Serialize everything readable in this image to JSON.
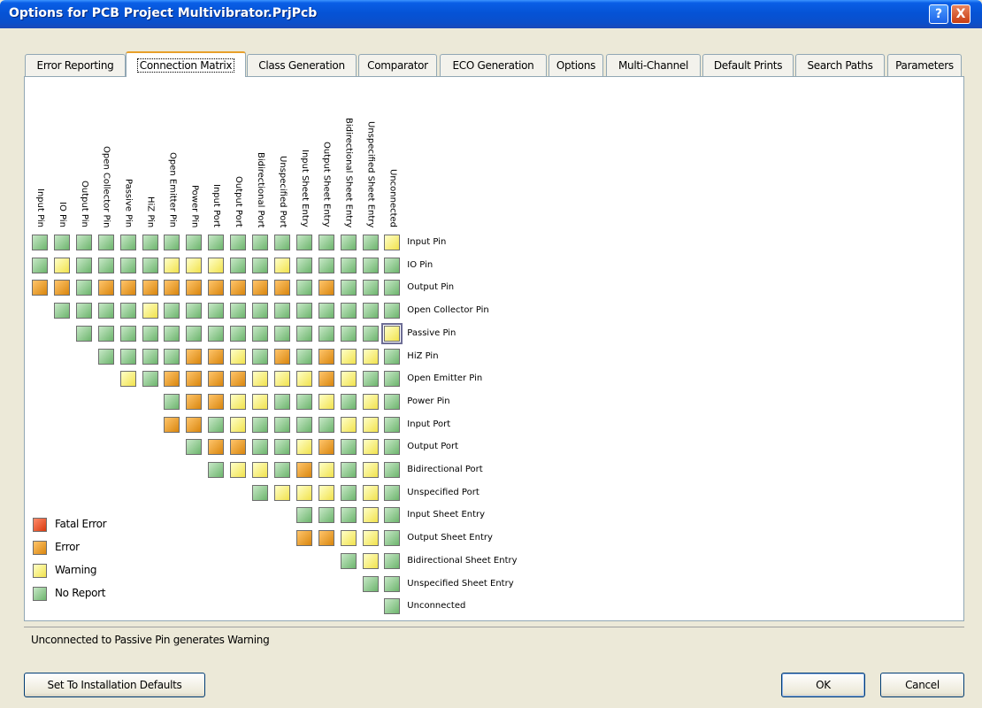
{
  "window": {
    "title": "Options for PCB Project Multivibrator.PrjPcb",
    "help_label": "?",
    "close_label": "X"
  },
  "tabs": [
    {
      "label": "Error Reporting"
    },
    {
      "label": "Connection Matrix"
    },
    {
      "label": "Class Generation"
    },
    {
      "label": "Comparator"
    },
    {
      "label": "ECO Generation"
    },
    {
      "label": "Options"
    },
    {
      "label": "Multi-Channel"
    },
    {
      "label": "Default Prints"
    },
    {
      "label": "Search Paths"
    },
    {
      "label": "Parameters"
    }
  ],
  "active_tab": "Connection Matrix",
  "matrix": {
    "labels": [
      "Input Pin",
      "IO Pin",
      "Output Pin",
      "Open Collector Pin",
      "Passive Pin",
      "HiZ Pin",
      "Open Emitter Pin",
      "Power Pin",
      "Input Port",
      "Output Port",
      "Bidirectional Port",
      "Unspecified Port",
      "Input Sheet Entry",
      "Output Sheet Entry",
      "Bidirectional Sheet Entry",
      "Unspecified Sheet Entry",
      "Unconnected"
    ],
    "levels": {
      "g": "No Report",
      "y": "Warning",
      "o": "Error",
      "r": "Fatal Error"
    },
    "rows": [
      "ggggggggggggggggy",
      "gyggggyyyggyggggg",
      "oogooooooooogoggg",
      "ggggyggggggggggg",
      "ggggggggggggggy",
      "ggggooygogoyyg",
      "ygooooyyyoygg",
      "gooyyggygyg",
      "oogyggggyyg",
      "googgyogyg",
      "gyygoygyg",
      "gyyygyg",
      "gggyg",
      "ooyyg",
      "gyg",
      "gg",
      "g"
    ],
    "selected": {
      "row": 4,
      "col": 16
    }
  },
  "legend": [
    {
      "label": "Fatal Error",
      "level": "r"
    },
    {
      "label": "Error",
      "level": "o"
    },
    {
      "label": "Warning",
      "level": "y"
    },
    {
      "label": "No Report",
      "level": "g"
    }
  ],
  "status_text": "Unconnected to Passive Pin generates Warning",
  "buttons": {
    "defaults": "Set To Installation Defaults",
    "ok": "OK",
    "cancel": "Cancel"
  },
  "colors": {
    "no_report": "#8fcc8f",
    "warning": "#f7ee8a",
    "error": "#e9a33a",
    "fatal": "#e8532c",
    "title_bar": "#0553d6"
  }
}
